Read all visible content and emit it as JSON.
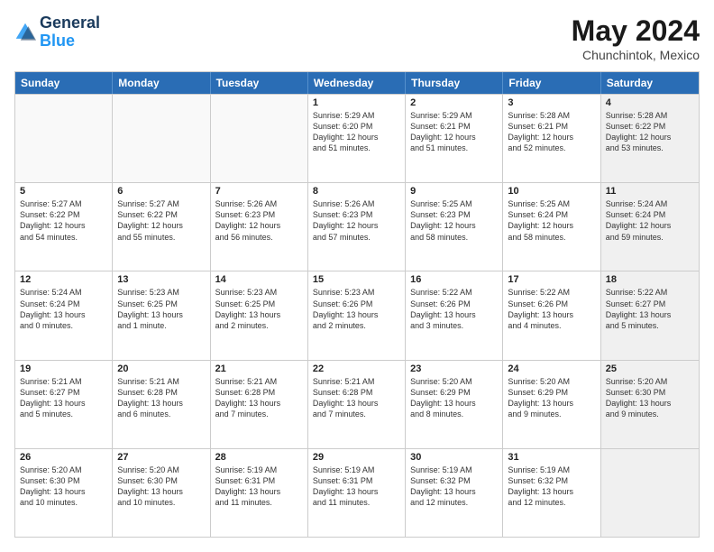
{
  "logo": {
    "line1": "General",
    "line2": "Blue"
  },
  "title": "May 2024",
  "location": "Chunchintok, Mexico",
  "days_of_week": [
    "Sunday",
    "Monday",
    "Tuesday",
    "Wednesday",
    "Thursday",
    "Friday",
    "Saturday"
  ],
  "weeks": [
    [
      {
        "day": "",
        "text": "",
        "empty": true
      },
      {
        "day": "",
        "text": "",
        "empty": true
      },
      {
        "day": "",
        "text": "",
        "empty": true
      },
      {
        "day": "1",
        "text": "Sunrise: 5:29 AM\nSunset: 6:20 PM\nDaylight: 12 hours\nand 51 minutes."
      },
      {
        "day": "2",
        "text": "Sunrise: 5:29 AM\nSunset: 6:21 PM\nDaylight: 12 hours\nand 51 minutes."
      },
      {
        "day": "3",
        "text": "Sunrise: 5:28 AM\nSunset: 6:21 PM\nDaylight: 12 hours\nand 52 minutes."
      },
      {
        "day": "4",
        "text": "Sunrise: 5:28 AM\nSunset: 6:22 PM\nDaylight: 12 hours\nand 53 minutes.",
        "shaded": true
      }
    ],
    [
      {
        "day": "5",
        "text": "Sunrise: 5:27 AM\nSunset: 6:22 PM\nDaylight: 12 hours\nand 54 minutes."
      },
      {
        "day": "6",
        "text": "Sunrise: 5:27 AM\nSunset: 6:22 PM\nDaylight: 12 hours\nand 55 minutes."
      },
      {
        "day": "7",
        "text": "Sunrise: 5:26 AM\nSunset: 6:23 PM\nDaylight: 12 hours\nand 56 minutes."
      },
      {
        "day": "8",
        "text": "Sunrise: 5:26 AM\nSunset: 6:23 PM\nDaylight: 12 hours\nand 57 minutes."
      },
      {
        "day": "9",
        "text": "Sunrise: 5:25 AM\nSunset: 6:23 PM\nDaylight: 12 hours\nand 58 minutes."
      },
      {
        "day": "10",
        "text": "Sunrise: 5:25 AM\nSunset: 6:24 PM\nDaylight: 12 hours\nand 58 minutes."
      },
      {
        "day": "11",
        "text": "Sunrise: 5:24 AM\nSunset: 6:24 PM\nDaylight: 12 hours\nand 59 minutes.",
        "shaded": true
      }
    ],
    [
      {
        "day": "12",
        "text": "Sunrise: 5:24 AM\nSunset: 6:24 PM\nDaylight: 13 hours\nand 0 minutes."
      },
      {
        "day": "13",
        "text": "Sunrise: 5:23 AM\nSunset: 6:25 PM\nDaylight: 13 hours\nand 1 minute."
      },
      {
        "day": "14",
        "text": "Sunrise: 5:23 AM\nSunset: 6:25 PM\nDaylight: 13 hours\nand 2 minutes."
      },
      {
        "day": "15",
        "text": "Sunrise: 5:23 AM\nSunset: 6:26 PM\nDaylight: 13 hours\nand 2 minutes."
      },
      {
        "day": "16",
        "text": "Sunrise: 5:22 AM\nSunset: 6:26 PM\nDaylight: 13 hours\nand 3 minutes."
      },
      {
        "day": "17",
        "text": "Sunrise: 5:22 AM\nSunset: 6:26 PM\nDaylight: 13 hours\nand 4 minutes."
      },
      {
        "day": "18",
        "text": "Sunrise: 5:22 AM\nSunset: 6:27 PM\nDaylight: 13 hours\nand 5 minutes.",
        "shaded": true
      }
    ],
    [
      {
        "day": "19",
        "text": "Sunrise: 5:21 AM\nSunset: 6:27 PM\nDaylight: 13 hours\nand 5 minutes."
      },
      {
        "day": "20",
        "text": "Sunrise: 5:21 AM\nSunset: 6:28 PM\nDaylight: 13 hours\nand 6 minutes."
      },
      {
        "day": "21",
        "text": "Sunrise: 5:21 AM\nSunset: 6:28 PM\nDaylight: 13 hours\nand 7 minutes."
      },
      {
        "day": "22",
        "text": "Sunrise: 5:21 AM\nSunset: 6:28 PM\nDaylight: 13 hours\nand 7 minutes."
      },
      {
        "day": "23",
        "text": "Sunrise: 5:20 AM\nSunset: 6:29 PM\nDaylight: 13 hours\nand 8 minutes."
      },
      {
        "day": "24",
        "text": "Sunrise: 5:20 AM\nSunset: 6:29 PM\nDaylight: 13 hours\nand 9 minutes."
      },
      {
        "day": "25",
        "text": "Sunrise: 5:20 AM\nSunset: 6:30 PM\nDaylight: 13 hours\nand 9 minutes.",
        "shaded": true
      }
    ],
    [
      {
        "day": "26",
        "text": "Sunrise: 5:20 AM\nSunset: 6:30 PM\nDaylight: 13 hours\nand 10 minutes."
      },
      {
        "day": "27",
        "text": "Sunrise: 5:20 AM\nSunset: 6:30 PM\nDaylight: 13 hours\nand 10 minutes."
      },
      {
        "day": "28",
        "text": "Sunrise: 5:19 AM\nSunset: 6:31 PM\nDaylight: 13 hours\nand 11 minutes."
      },
      {
        "day": "29",
        "text": "Sunrise: 5:19 AM\nSunset: 6:31 PM\nDaylight: 13 hours\nand 11 minutes."
      },
      {
        "day": "30",
        "text": "Sunrise: 5:19 AM\nSunset: 6:32 PM\nDaylight: 13 hours\nand 12 minutes."
      },
      {
        "day": "31",
        "text": "Sunrise: 5:19 AM\nSunset: 6:32 PM\nDaylight: 13 hours\nand 12 minutes."
      },
      {
        "day": "",
        "text": "",
        "empty": true,
        "shaded": true
      }
    ]
  ]
}
